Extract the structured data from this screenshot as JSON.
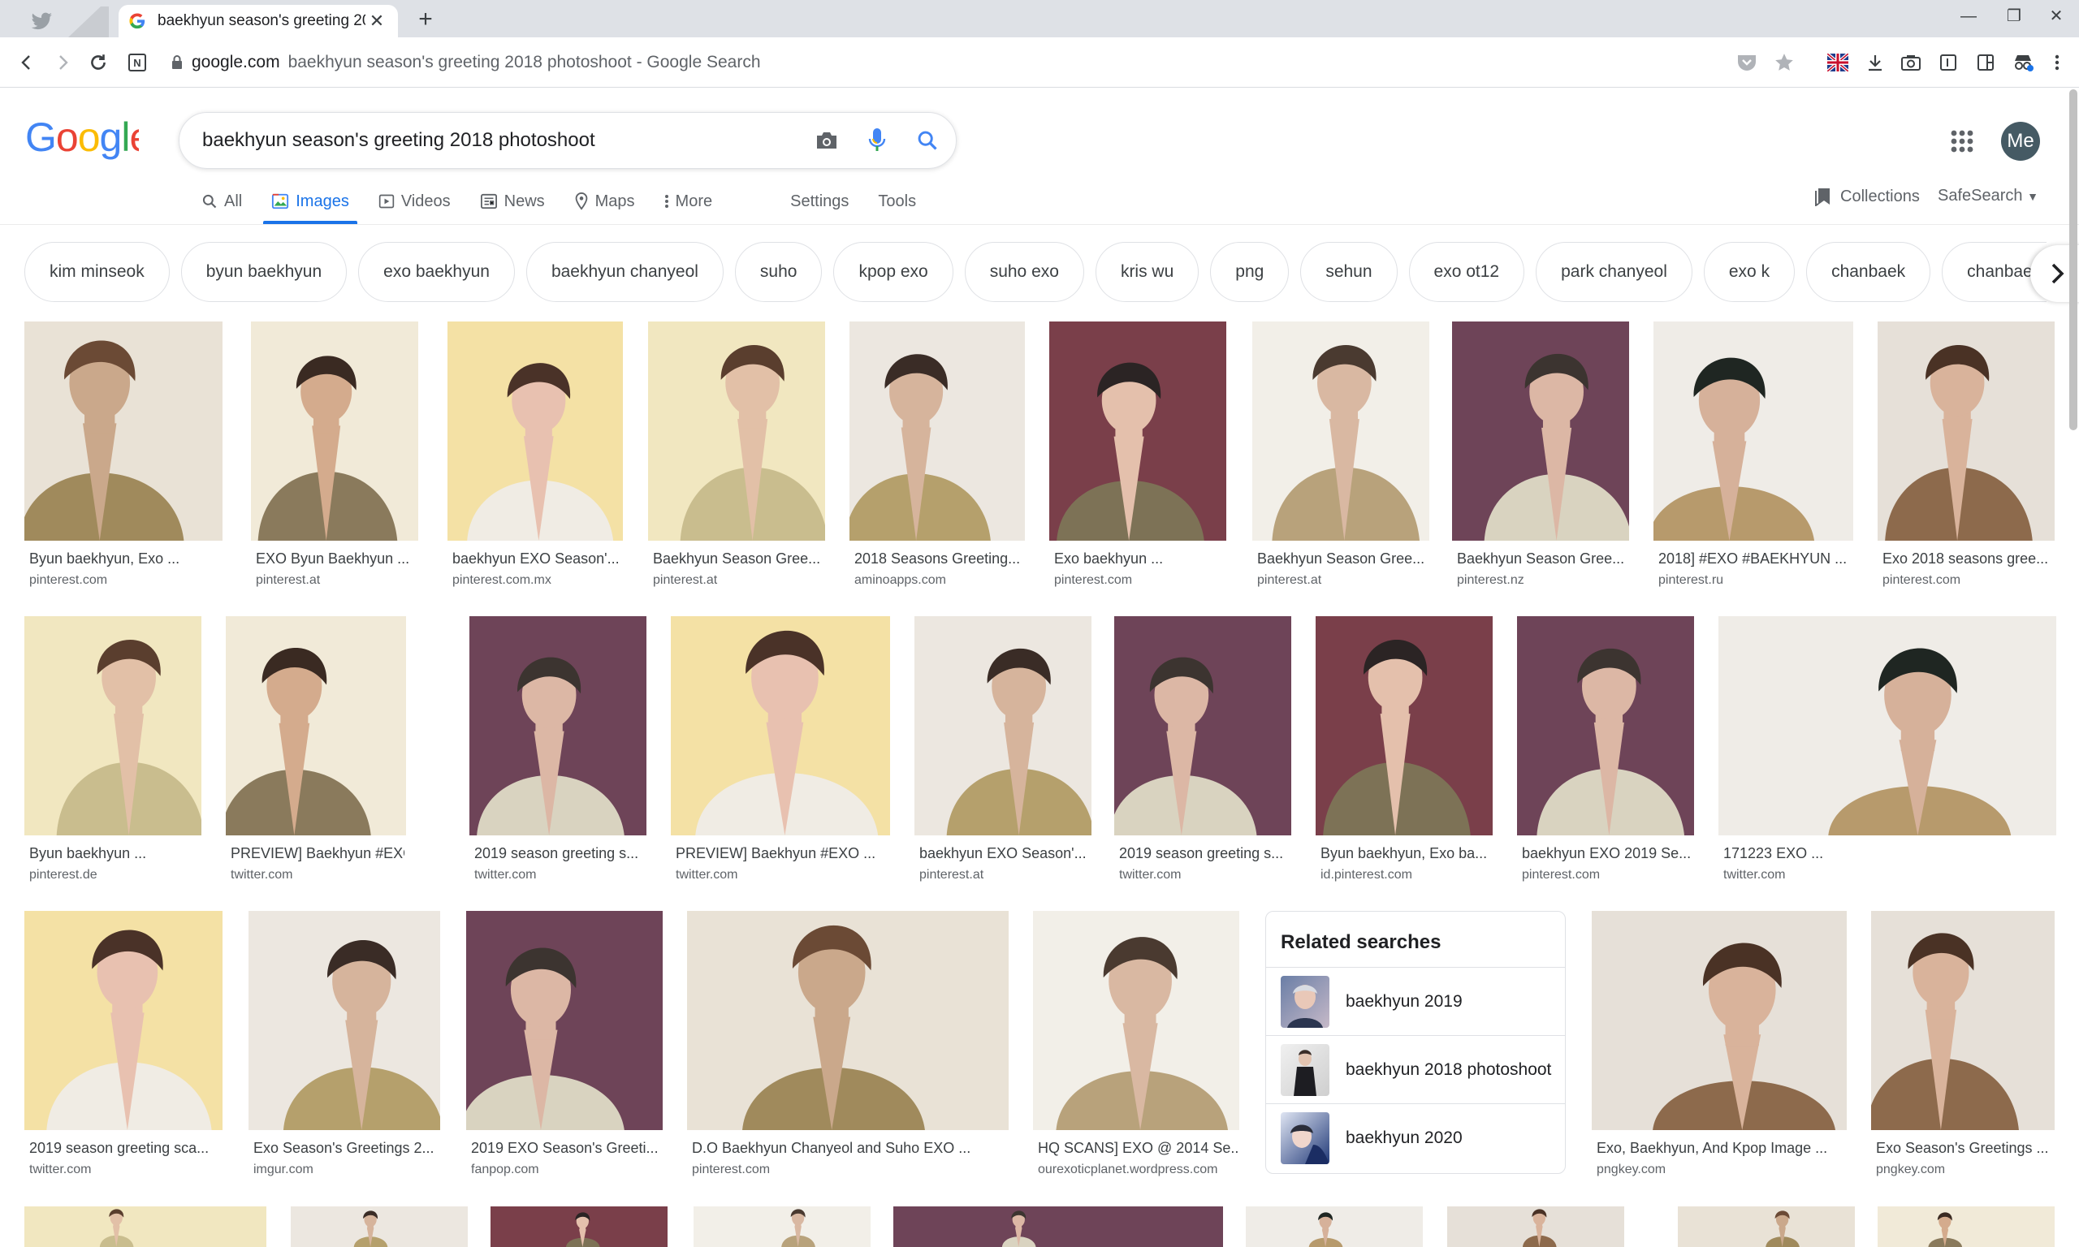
{
  "browser": {
    "tab_title": "baekhyun season's greeting 20",
    "url_domain": "google.com",
    "url_rest": "baekhyun season's greeting 2018 photoshoot - Google Search",
    "new_tab": "+"
  },
  "search": {
    "query": "baekhyun season's greeting 2018 photoshoot"
  },
  "avatar_label": "Me",
  "nav": {
    "tabs": [
      {
        "label": "All",
        "icon": "search-icon"
      },
      {
        "label": "Images",
        "icon": "image-icon",
        "active": true
      },
      {
        "label": "Videos",
        "icon": "video-icon"
      },
      {
        "label": "News",
        "icon": "news-icon"
      },
      {
        "label": "Maps",
        "icon": "map-pin-icon"
      },
      {
        "label": "More",
        "icon": "more-vert-icon"
      }
    ],
    "settings": "Settings",
    "tools": "Tools",
    "collections": "Collections",
    "safesearch": "SafeSearch"
  },
  "chips": [
    "kim minseok",
    "byun baekhyun",
    "exo baekhyun",
    "baekhyun chanyeol",
    "suho",
    "kpop exo",
    "suho exo",
    "kris wu",
    "png",
    "sehun",
    "exo ot12",
    "park chanyeol",
    "exo k",
    "chanbaek",
    "chanbaek e"
  ],
  "results": {
    "row1": [
      {
        "title": "Byun baekhyun, Exo ...",
        "source": "pinterest.com"
      },
      {
        "title": "EXO Byun Baekhyun ...",
        "source": "pinterest.at"
      },
      {
        "title": "baekhyun EXO Season'...",
        "source": "pinterest.com.mx"
      },
      {
        "title": "Baekhyun Season Gree...",
        "source": "pinterest.at"
      },
      {
        "title": "2018 Seasons Greeting...",
        "source": "aminoapps.com"
      },
      {
        "title": "Exo baekhyun ...",
        "source": "pinterest.com"
      },
      {
        "title": "Baekhyun Season Gree...",
        "source": "pinterest.at"
      },
      {
        "title": "Baekhyun Season Gree...",
        "source": "pinterest.nz"
      },
      {
        "title": "2018] #EXO #BAEKHYUN ...",
        "source": "pinterest.ru"
      },
      {
        "title": "Exo 2018 seasons gree...",
        "source": "pinterest.com"
      }
    ],
    "row2": [
      {
        "title": "Byun baekhyun ...",
        "source": "pinterest.de"
      },
      {
        "title": "PREVIEW] Baekhyun #EXO ...",
        "source": "twitter.com"
      },
      {
        "title": "2019 season greeting s...",
        "source": "twitter.com"
      },
      {
        "title": "PREVIEW] Baekhyun #EXO ...",
        "source": "twitter.com"
      },
      {
        "title": "baekhyun EXO Season'...",
        "source": "pinterest.at"
      },
      {
        "title": "2019 season greeting s...",
        "source": "twitter.com"
      },
      {
        "title": "Byun baekhyun, Exo ba...",
        "source": "id.pinterest.com"
      },
      {
        "title": "baekhyun EXO 2019 Se...",
        "source": "pinterest.com"
      },
      {
        "title": "171223 EXO ...",
        "source": "twitter.com"
      }
    ],
    "row3": [
      {
        "title": "2019 season greeting sca...",
        "source": "twitter.com"
      },
      {
        "title": "Exo Season's Greetings 2...",
        "source": "imgur.com"
      },
      {
        "title": "2019 EXO Season's Greeti...",
        "source": "fanpop.com"
      },
      {
        "title": "D.O Baekhyun Chanyeol and Suho EXO ...",
        "source": "pinterest.com"
      },
      {
        "title": "HQ SCANS] EXO @ 2014 Se...",
        "source": "ourexoticplanet.wordpress.com"
      },
      {
        "title": "Exo, Baekhyun, And Kpop Image ...",
        "source": "pngkey.com"
      },
      {
        "title": "Exo Season's Greetings ...",
        "source": "pngkey.com"
      }
    ]
  },
  "related": {
    "title": "Related searches",
    "items": [
      "baekhyun 2019",
      "baekhyun 2018 photoshoot",
      "baekhyun 2020"
    ]
  }
}
